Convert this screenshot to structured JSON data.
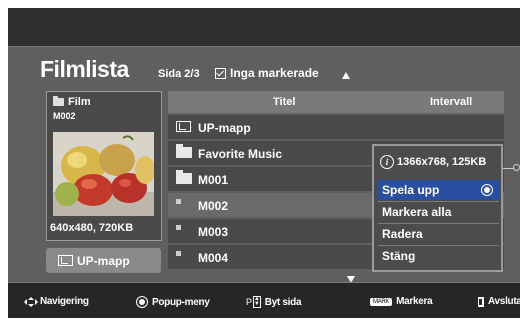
{
  "page": {
    "title": "Filmlista",
    "page_indicator": "Sida 2/3",
    "mark_status": "Inga markerade"
  },
  "preview": {
    "header": "Film",
    "code": "M002",
    "info": "640x480, 720KB",
    "image_icon": "fruit-photo-thumbnail"
  },
  "up_button": {
    "label": "UP-mapp"
  },
  "list": {
    "columns": {
      "title": "Titel",
      "interval": "Intervall"
    },
    "rows": [
      {
        "label": "UP-mapp",
        "icon": "up-folder-icon",
        "selected": false
      },
      {
        "label": "Favorite Music",
        "icon": "folder-icon",
        "selected": false
      },
      {
        "label": "M001",
        "icon": "folder-icon",
        "selected": false
      },
      {
        "label": "M002",
        "icon": "file-bullet-icon",
        "selected": true
      },
      {
        "label": "M003",
        "icon": "file-bullet-icon",
        "selected": false
      },
      {
        "label": "M004",
        "icon": "file-bullet-icon",
        "selected": false
      }
    ]
  },
  "popup": {
    "info": "1366x768, 125KB",
    "items": [
      "Spela upp",
      "Markera alla",
      "Radera",
      "Stäng"
    ],
    "active_index": 0
  },
  "footer": {
    "navigate": "Navigering",
    "popup_menu": "Popup-meny",
    "page_key": "P",
    "switch_page": "Byt sida",
    "mark_key": "MARK",
    "mark": "Markera",
    "exit": "Avsluta"
  },
  "colors": {
    "background": "#5f5f5f",
    "header_bar": "#2f2f2f",
    "row": "#4a4a4a",
    "row_selected": "#6a6a6a",
    "popup_active": "#2a4fa0"
  }
}
